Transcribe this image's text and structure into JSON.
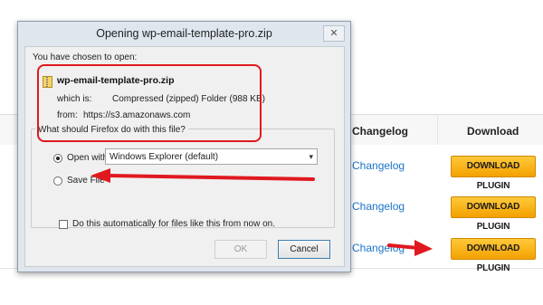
{
  "background_page": {
    "columns": {
      "changelog": "Changelog",
      "download": "Download"
    },
    "rows": [
      {
        "changelog": "Changelog",
        "download": "DOWNLOAD PLUGIN"
      },
      {
        "changelog": "Changelog",
        "download": "DOWNLOAD PLUGIN"
      },
      {
        "changelog": "Changelog",
        "download": "DOWNLOAD PLUGIN"
      }
    ],
    "button_color": "#f5a800",
    "link_color": "#1a73c8"
  },
  "dialog": {
    "title": "Opening wp-email-template-pro.zip",
    "close_glyph": "✕",
    "chosen_label": "You have chosen to open:",
    "file_icon": "zip-file-icon",
    "filename": "wp-email-template-pro.zip",
    "which_is_label": "which is:",
    "which_is_value": "Compressed (zipped) Folder (988 KB)",
    "from_label": "from:",
    "from_value": "https://s3.amazonaws.com",
    "group_title": "What should Firefox do with this file?",
    "open_with_label": "Open with",
    "open_with_value": "Windows Explorer (default)",
    "save_file_label": "Save File",
    "auto_label": "Do this automatically for files like this from now on.",
    "ok_label": "OK",
    "cancel_label": "Cancel",
    "selected_option": "open_with",
    "auto_checked": false
  },
  "annotation_color": "#e0191f"
}
